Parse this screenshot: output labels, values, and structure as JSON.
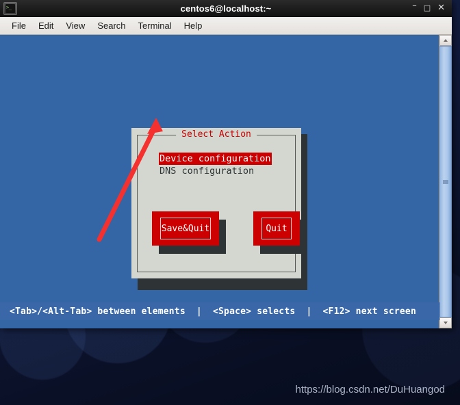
{
  "window": {
    "title": "centos6@localhost:~",
    "icon": "terminal-icon",
    "controls": {
      "minimize": "–",
      "maximize": "□",
      "close": "✕"
    }
  },
  "menubar": {
    "items": [
      {
        "label": "File"
      },
      {
        "label": "Edit"
      },
      {
        "label": "View"
      },
      {
        "label": "Search"
      },
      {
        "label": "Terminal"
      },
      {
        "label": "Help"
      }
    ]
  },
  "dialog": {
    "title": "Select Action",
    "options": [
      {
        "label": "Device configuration",
        "selected": true
      },
      {
        "label": "DNS configuration",
        "selected": false
      }
    ],
    "buttons": [
      {
        "label": "Save&Quit"
      },
      {
        "label": "Quit"
      }
    ]
  },
  "statusbar": {
    "text": "<Tab>/<Alt-Tab> between elements  |  <Space> selects  |  <F12> next screen"
  },
  "watermark": {
    "text": "https://blog.csdn.net/DuHuangod"
  },
  "colors": {
    "terminal_background": "#3465A4",
    "dialog_background": "#D3D7CF",
    "dialog_shadow": "#2E3436",
    "accent_red": "#CC0000",
    "statusbar_background": "#3A67A8",
    "annotation_arrow": "#F5312F"
  }
}
